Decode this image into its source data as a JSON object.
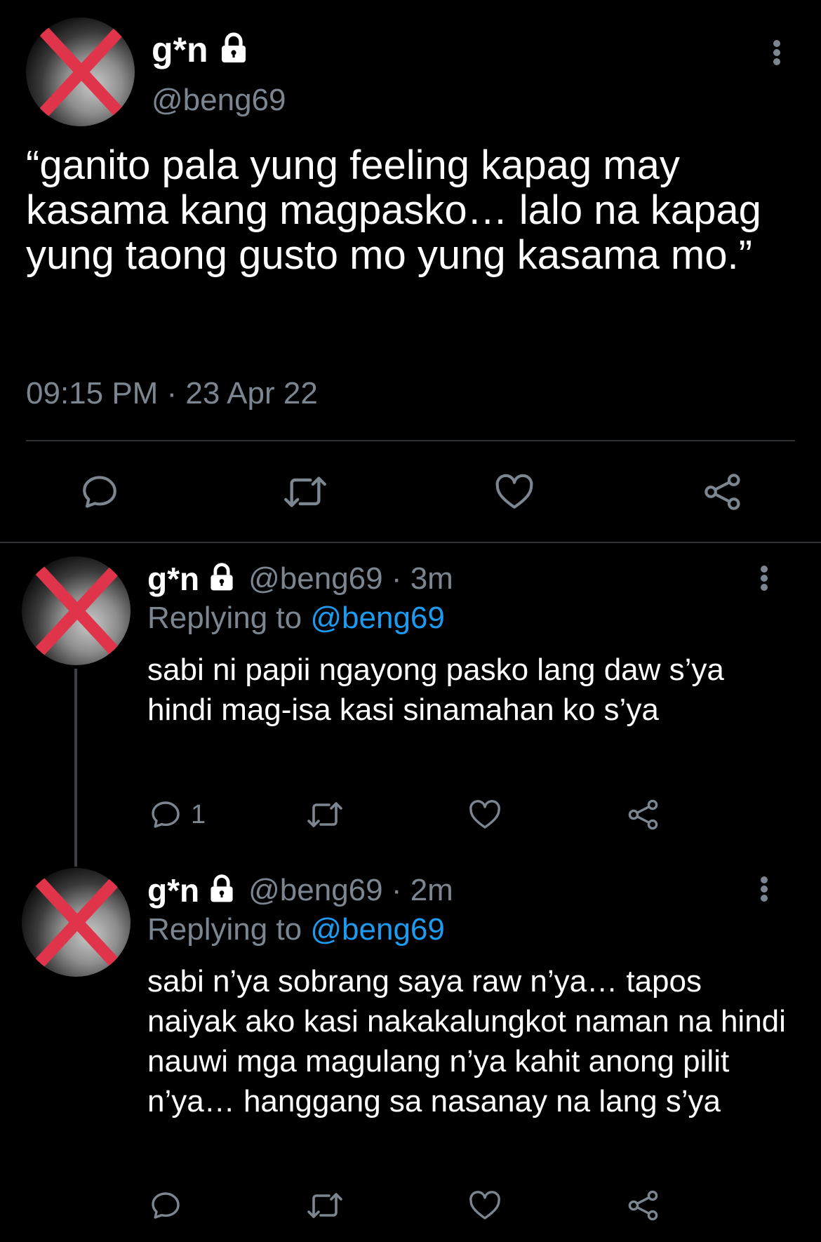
{
  "main_tweet": {
    "display_name": "g*n",
    "handle": "@beng69",
    "text": "“ganito pala yung feeling kapag may kasama kang magpasko… lalo na kapag yung taong gusto mo yung kasama mo.”",
    "timestamp": "09:15 PM · 23 Apr 22",
    "icons": [
      "comment-icon",
      "retweet-icon",
      "like-icon",
      "share-icon",
      "lock-icon",
      "more-options-icon"
    ]
  },
  "replies": [
    {
      "display_name": "g*n",
      "handle_time": "@beng69 · 3m",
      "replying_label": "Replying to",
      "replying_to": "@beng69",
      "text": "sabi ni papii ngayong pasko lang daw s’ya hindi mag-isa kasi sinamahan ko s’ya",
      "reply_count": "1"
    },
    {
      "display_name": "g*n",
      "handle_time": "@beng69 · 2m",
      "replying_label": "Replying to",
      "replying_to": "@beng69",
      "text": "sabi n’ya sobrang saya raw n’ya… tapos naiyak ako kasi nakakalungkot naman na hindi nauwi mga magulang n’ya kahit anong pilit n’ya… hanggang sa nasanay na lang s’ya",
      "reply_count": ""
    }
  ],
  "colors": {
    "background": "#000000",
    "text": "#ffffff",
    "secondary": "#7c8690",
    "link": "#1d9bf0",
    "avatar_cross": "#e0344a",
    "divider": "#2f3336"
  }
}
